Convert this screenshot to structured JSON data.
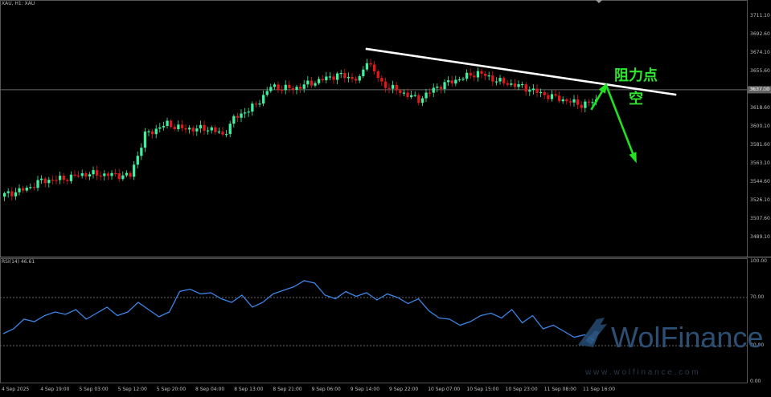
{
  "instrument_label": "XAU, H1:  XAU",
  "rsi_label": "RSI(14) 46.61",
  "current_price_tag": "3637.00",
  "annotations": {
    "resistance": "阻力点",
    "short": "空"
  },
  "watermark": {
    "brand": "WolFinance",
    "url": "w w w . w o l f i n a n c e . c o m"
  },
  "colors": {
    "background": "#000000",
    "bull_candle": "#3ff0a0",
    "bear_candle": "#e01818",
    "trendline": "#ffffff",
    "arrows": "#22e022",
    "rsi_line": "#3a86e8",
    "grid_dotted": "#6a6a6a",
    "axis_text": "#bdbdbd"
  },
  "chart_data": [
    {
      "type": "candlestick",
      "title": "XAU, H1:  XAU",
      "ylim": [
        3470,
        3722
      ],
      "y_ticks": [
        "3711.10",
        "3692.60",
        "3674.10",
        "3655.60",
        "3637.10",
        "3618.60",
        "3600.10",
        "3581.60",
        "3563.10",
        "3544.60",
        "3526.10",
        "3507.60",
        "3489.10"
      ],
      "x_ticks": [
        "4 Sep 2025",
        "4 Sep 19:00",
        "5 Sep 03:00",
        "5 Sep 12:00",
        "5 Sep 20:00",
        "8 Sep 04:00",
        "8 Sep 13:00",
        "8 Sep 21:00",
        "9 Sep 06:00",
        "9 Sep 14:00",
        "9 Sep 22:00",
        "10 Sep 07:00",
        "10 Sep 15:00",
        "10 Sep 23:00",
        "11 Sep 08:00",
        "11 Sep 16:00"
      ],
      "close_path": [
        {
          "bar": 0,
          "close": 3532
        },
        {
          "bar": 6,
          "close": 3538
        },
        {
          "bar": 10,
          "close": 3546
        },
        {
          "bar": 16,
          "close": 3548
        },
        {
          "bar": 22,
          "close": 3553
        },
        {
          "bar": 28,
          "close": 3552
        },
        {
          "bar": 34,
          "close": 3551
        },
        {
          "bar": 38,
          "close": 3592
        },
        {
          "bar": 44,
          "close": 3603
        },
        {
          "bar": 48,
          "close": 3598
        },
        {
          "bar": 56,
          "close": 3598
        },
        {
          "bar": 59,
          "close": 3591
        },
        {
          "bar": 62,
          "close": 3608
        },
        {
          "bar": 68,
          "close": 3622
        },
        {
          "bar": 72,
          "close": 3640
        },
        {
          "bar": 78,
          "close": 3638
        },
        {
          "bar": 84,
          "close": 3645
        },
        {
          "bar": 90,
          "close": 3652
        },
        {
          "bar": 96,
          "close": 3647
        },
        {
          "bar": 98,
          "close": 3667
        },
        {
          "bar": 102,
          "close": 3643
        },
        {
          "bar": 107,
          "close": 3635
        },
        {
          "bar": 112,
          "close": 3627
        },
        {
          "bar": 117,
          "close": 3640
        },
        {
          "bar": 123,
          "close": 3648
        },
        {
          "bar": 128,
          "close": 3654
        },
        {
          "bar": 134,
          "close": 3645
        },
        {
          "bar": 140,
          "close": 3640
        },
        {
          "bar": 146,
          "close": 3632
        },
        {
          "bar": 152,
          "close": 3626
        },
        {
          "bar": 156,
          "close": 3622
        },
        {
          "bar": 160,
          "close": 3626
        }
      ],
      "trendline": {
        "from": {
          "bar": 98,
          "price": 3678
        },
        "to": {
          "bar": 182,
          "price": 3632
        }
      },
      "arrow_up": {
        "from": {
          "bar": 159,
          "price": 3617
        },
        "to": {
          "bar": 163,
          "price": 3642
        }
      },
      "arrow_down": {
        "from": {
          "bar": 163,
          "price": 3642
        },
        "to": {
          "bar": 171,
          "price": 3566
        }
      },
      "current_price": 3637.0
    },
    {
      "type": "line",
      "title": "RSI(14) 46.61",
      "ylim": [
        0,
        100
      ],
      "y_ticks": [
        "100.00",
        "70.00",
        "30.00",
        "0.00"
      ],
      "levels": [
        70,
        30
      ],
      "series": [
        {
          "values": [
            40,
            44,
            52,
            50,
            55,
            58,
            56,
            60,
            52,
            57,
            62,
            55,
            58,
            66,
            60,
            54,
            58,
            75,
            77,
            73,
            74,
            69,
            66,
            72,
            62,
            66,
            73,
            76,
            79,
            84,
            82,
            72,
            69,
            75,
            71,
            74,
            68,
            73,
            70,
            65,
            69,
            59,
            53,
            52,
            47,
            50,
            55,
            57,
            53,
            60,
            49,
            55,
            44,
            47,
            42,
            37,
            39,
            34
          ]
        }
      ]
    }
  ]
}
